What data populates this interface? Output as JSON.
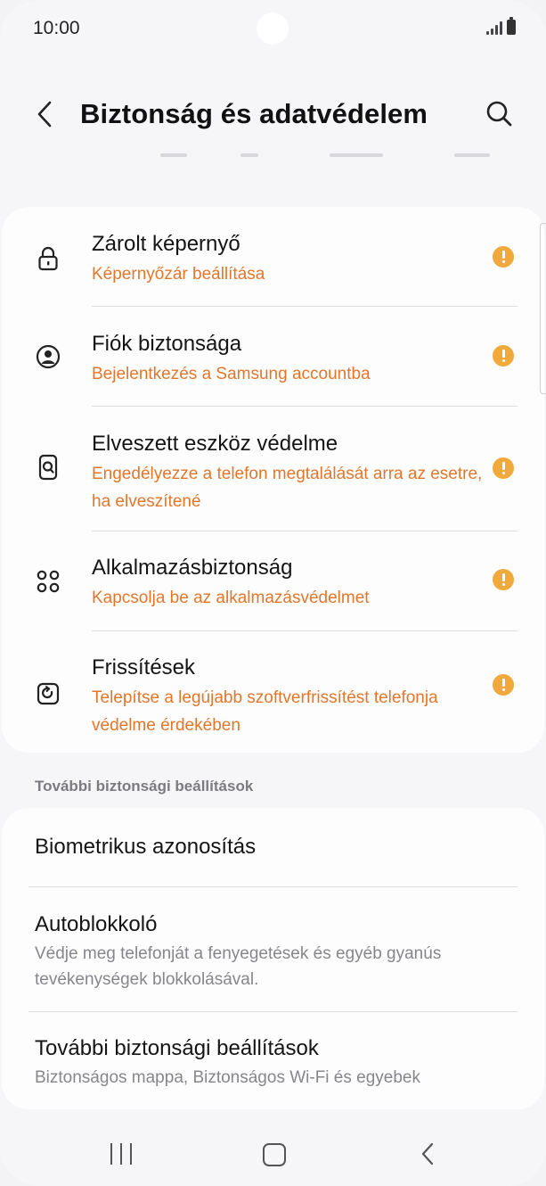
{
  "status_bar": {
    "time": "10:00"
  },
  "header": {
    "title": "Biztonság és adatvédelem"
  },
  "security_items": [
    {
      "title": "Zárolt képernyő",
      "subtitle": "Képernyőzár beállítása",
      "icon": "lock-icon"
    },
    {
      "title": "Fiók biztonsága",
      "subtitle": "Bejelentkezés a Samsung accountba",
      "icon": "account-icon"
    },
    {
      "title": "Elveszett eszköz védelme",
      "subtitle": "Engedélyezze a telefon megtalálását arra az esetre, ha elveszítené",
      "icon": "find-device-icon"
    },
    {
      "title": "Alkalmazásbiztonság",
      "subtitle": "Kapcsolja be az alkalmazásvédelmet",
      "icon": "apps-icon"
    },
    {
      "title": "Frissítések",
      "subtitle": "Telepítse a legújabb szoftverfrissítést telefonja védelme érdekében",
      "icon": "update-icon"
    }
  ],
  "section": {
    "header": "További biztonsági beállítások"
  },
  "more_items": [
    {
      "title": "Biometrikus azonosítás",
      "subtitle": ""
    },
    {
      "title": "Autoblokkoló",
      "subtitle": "Védje meg telefonját a fenyegetések és egyéb gyanús tevékenységek blokkolásával."
    },
    {
      "title": "További biztonsági beállítások",
      "subtitle": "Biztonságos mappa, Biztonságos Wi-Fi és egyebek"
    }
  ],
  "colors": {
    "accent_orange": "#e2772b",
    "warning": "#f0a93a"
  }
}
